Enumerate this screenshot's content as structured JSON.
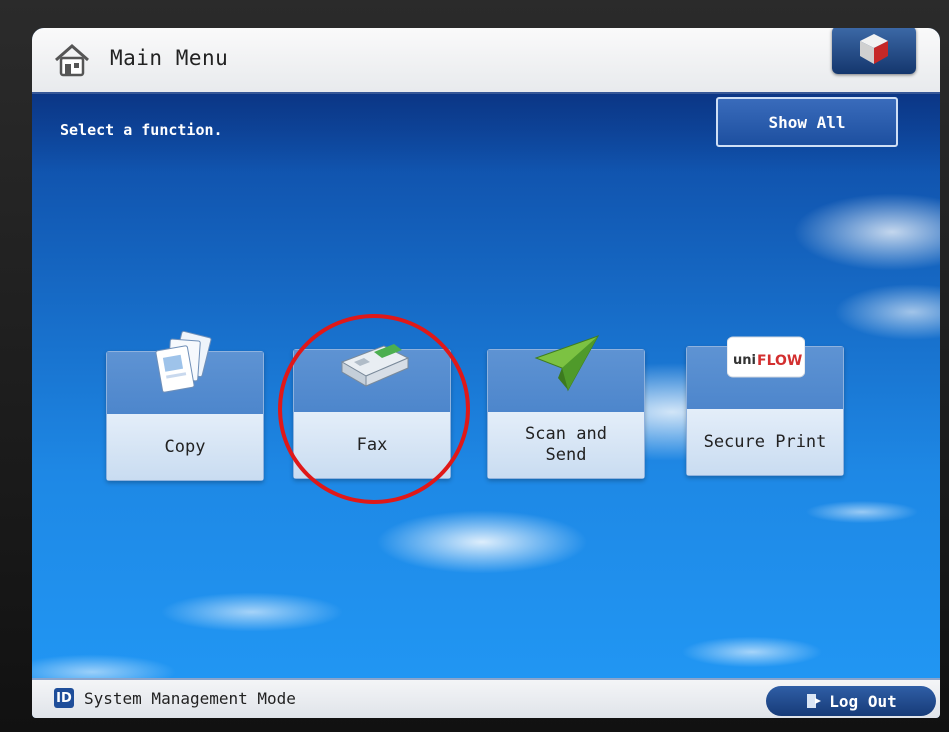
{
  "header": {
    "title": "Main Menu",
    "home_icon": "home-icon",
    "corner_icon": "cube-icon"
  },
  "main": {
    "instruction": "Select a function.",
    "show_all_label": "Show All",
    "functions": [
      {
        "label": "Copy",
        "icon": "copy-icon"
      },
      {
        "label": "Fax",
        "icon": "fax-icon"
      },
      {
        "label": "Scan and\nSend",
        "icon": "paper-plane-icon"
      },
      {
        "label": "Secure Print",
        "icon": "uniflow-icon",
        "logo_text": "uniFLOW"
      }
    ],
    "annotation": {
      "shape": "circle",
      "color": "#e01818",
      "target": "Fax"
    }
  },
  "status_bar": {
    "id_badge": "ID",
    "mode_label": "System Management Mode",
    "logout_label": "Log Out"
  },
  "colors": {
    "title_bar": "#f0f1f3",
    "sky": "#1e88e5",
    "button_top": "#5e93d3",
    "button_bottom": "#d6e5f6",
    "logout": "#1f4e9a",
    "annotation": "#e01818"
  }
}
